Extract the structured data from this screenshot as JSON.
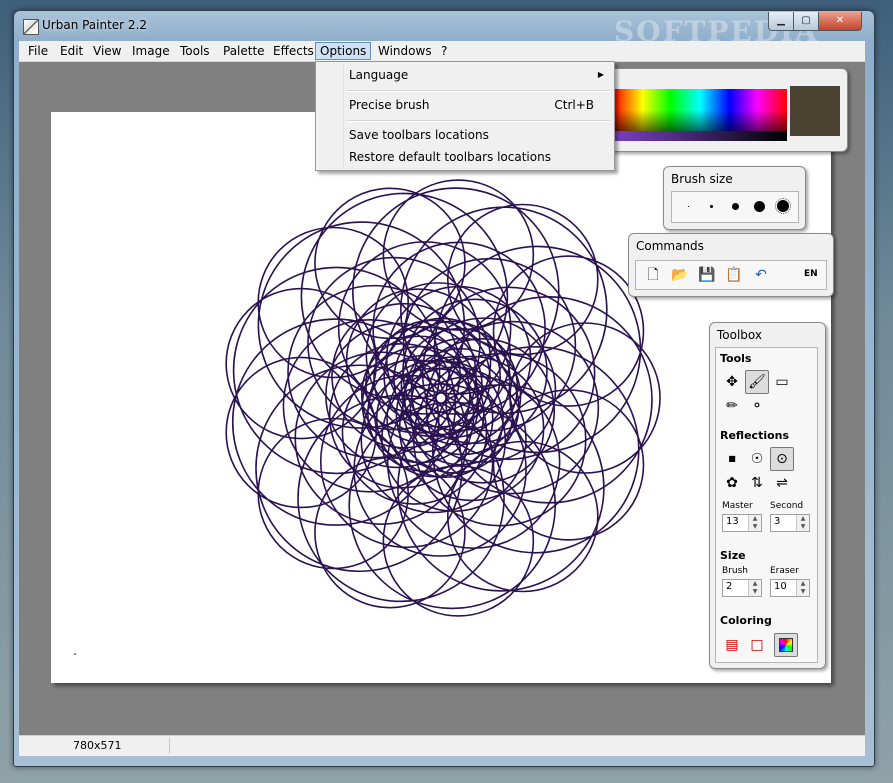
{
  "window": {
    "title": "Urban Painter 2.2",
    "watermark": "SOFTPEDIA",
    "controls": {
      "minimize": "▁",
      "maximize": "▢",
      "close": "✕"
    }
  },
  "menubar": {
    "items": [
      {
        "label": "File"
      },
      {
        "label": "Edit"
      },
      {
        "label": "View"
      },
      {
        "label": "Image"
      },
      {
        "label": "Tools"
      },
      {
        "label": "Palette"
      },
      {
        "label": "Effects"
      },
      {
        "label": "Options"
      },
      {
        "label": "Windows"
      },
      {
        "label": "?"
      }
    ]
  },
  "options_menu": {
    "language": "Language",
    "precise_brush": "Precise brush",
    "precise_brush_shortcut": "Ctrl+B",
    "save_toolbars": "Save toolbars locations",
    "restore_toolbars": "Restore default toolbars locations"
  },
  "palette": {
    "current_color": "#4b4230"
  },
  "brush_size_panel": {
    "title": "Brush size"
  },
  "commands_panel": {
    "title": "Commands",
    "language": "EN"
  },
  "toolbox": {
    "title": "Toolbox",
    "tools_label": "Tools",
    "reflections_label": "Reflections",
    "master_label": "Master",
    "master_value": "13",
    "second_label": "Second",
    "second_value": "3",
    "size_label": "Size",
    "brush_label": "Brush",
    "brush_value": "2",
    "eraser_label": "Eraser",
    "eraser_value": "10",
    "coloring_label": "Coloring"
  },
  "status": {
    "canvas_size": "780x571"
  },
  "drawing": {
    "stroke_color": "#2a1250",
    "master_reflections": 13,
    "second_reflections": 3
  }
}
